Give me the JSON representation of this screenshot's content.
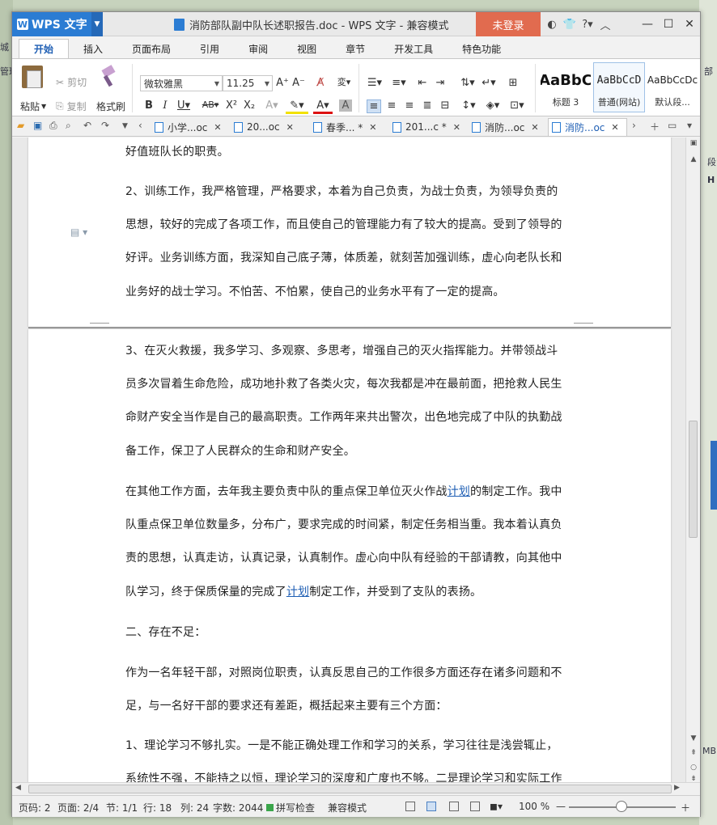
{
  "app": {
    "name": "WPS 文字",
    "logo_letter": "W",
    "doc_title": "消防部队副中队长述职报告.doc - WPS 文字 - 兼容模式",
    "login_label": "未登录",
    "title_icons": [
      "skin-icon",
      "shirt-icon",
      "help-icon",
      "collapse-icon"
    ],
    "window_controls": [
      "minimize",
      "maximize",
      "close"
    ]
  },
  "ribbon_tabs": [
    "开始",
    "插入",
    "页面布局",
    "引用",
    "审阅",
    "视图",
    "章节",
    "开发工具",
    "特色功能"
  ],
  "active_tab": "开始",
  "ribbon": {
    "paste_label": "粘贴",
    "cut_label": "剪切",
    "copy_label": "复制",
    "format_painter_label": "格式刷",
    "font_name": "微软雅黑",
    "font_size": "11.25",
    "styles": [
      {
        "sample": "AaBbC",
        "name": "标题 3"
      },
      {
        "sample": "AaBbCcD",
        "name": "普通(网站)"
      },
      {
        "sample": "AaBbCcDc",
        "name": "默认段..."
      }
    ]
  },
  "doc_tabs": [
    {
      "label": "小学...oc",
      "active": false
    },
    {
      "label": "20...oc",
      "active": false
    },
    {
      "label": "春季... *",
      "active": false
    },
    {
      "label": "201...c *",
      "active": false
    },
    {
      "label": "消防...oc",
      "active": false
    },
    {
      "label": "消防...oc",
      "active": true
    }
  ],
  "document": {
    "page1_lines": [
      "好值班队长的职责。",
      "2、训练工作，我严格管理，严格要求，本着为自己负责，为战士负责，为领导负责的",
      "思想，较好的完成了各项工作，而且使自己的管理能力有了较大的提高。受到了领导的",
      "好评。业务训练方面，我深知自己底子薄，体质差，就刻苦加强训练，虚心向老队长和",
      "业务好的战士学习。不怕苦、不怕累，使自己的业务水平有了一定的提高。"
    ],
    "page2_lines": [
      "3、在灭火救援，我多学习、多观察、多思考，增强自己的灭火指挥能力。并带领战斗",
      "员多次冒着生命危险，成功地扑救了各类火灾，每次我都是冲在最前面，把抢救人民生",
      "命财产安全当作是自己的最高职责。工作两年来共出警次，出色地完成了中队的执勤战",
      "备工作，保卫了人民群众的生命和财产安全。"
    ],
    "para_other_1_pre": "在其他工作方面，去年我主要负责中队的重点保卫单位灭火作战",
    "para_other_1_link": "计划",
    "para_other_1_post": "的制定工作。我中",
    "para_other_lines": [
      "队重点保卫单位数量多，分布广，要求完成的时间紧，制定任务相当重。我本着认真负",
      "责的思想，认真走访，认真记录，认真制作。虚心向中队有经验的干部请教，向其他中"
    ],
    "para_other_last_pre": "队学习，终于保质保量的完成了",
    "para_other_last_link": "计划",
    "para_other_last_post": "制定工作，并受到了支队的表扬。",
    "heading2": "二、存在不足：",
    "shortfall_lines": [
      "作为一名年轻干部，对照岗位职责，认真反思自己的工作很多方面还存在诸多问题和不",
      "足，与一名好干部的要求还有差距，概括起来主要有三个方面："
    ],
    "point1_lines": [
      "1、理论学习不够扎实。一是不能正确处理工作和学习的关系，学习往往是浅尝辄止，",
      "系统性不强，不能持之以恒，理论学习的深度和广度也不够。二是理论学习和实际工作"
    ]
  },
  "status": {
    "page_code": "页码: 2",
    "pages": "页面: 2/4",
    "section": "节: 1/1",
    "row": "行: 18",
    "col": "列: 24",
    "word_count": "字数: 2044",
    "spell_check": "拼写检查",
    "compat_mode": "兼容模式",
    "zoom": "100 %",
    "zoom_value": 100
  },
  "background": {
    "left_texts": [
      "城",
      "管理"
    ],
    "right_texts": [
      "部",
      "段",
      "H",
      "MB"
    ]
  }
}
